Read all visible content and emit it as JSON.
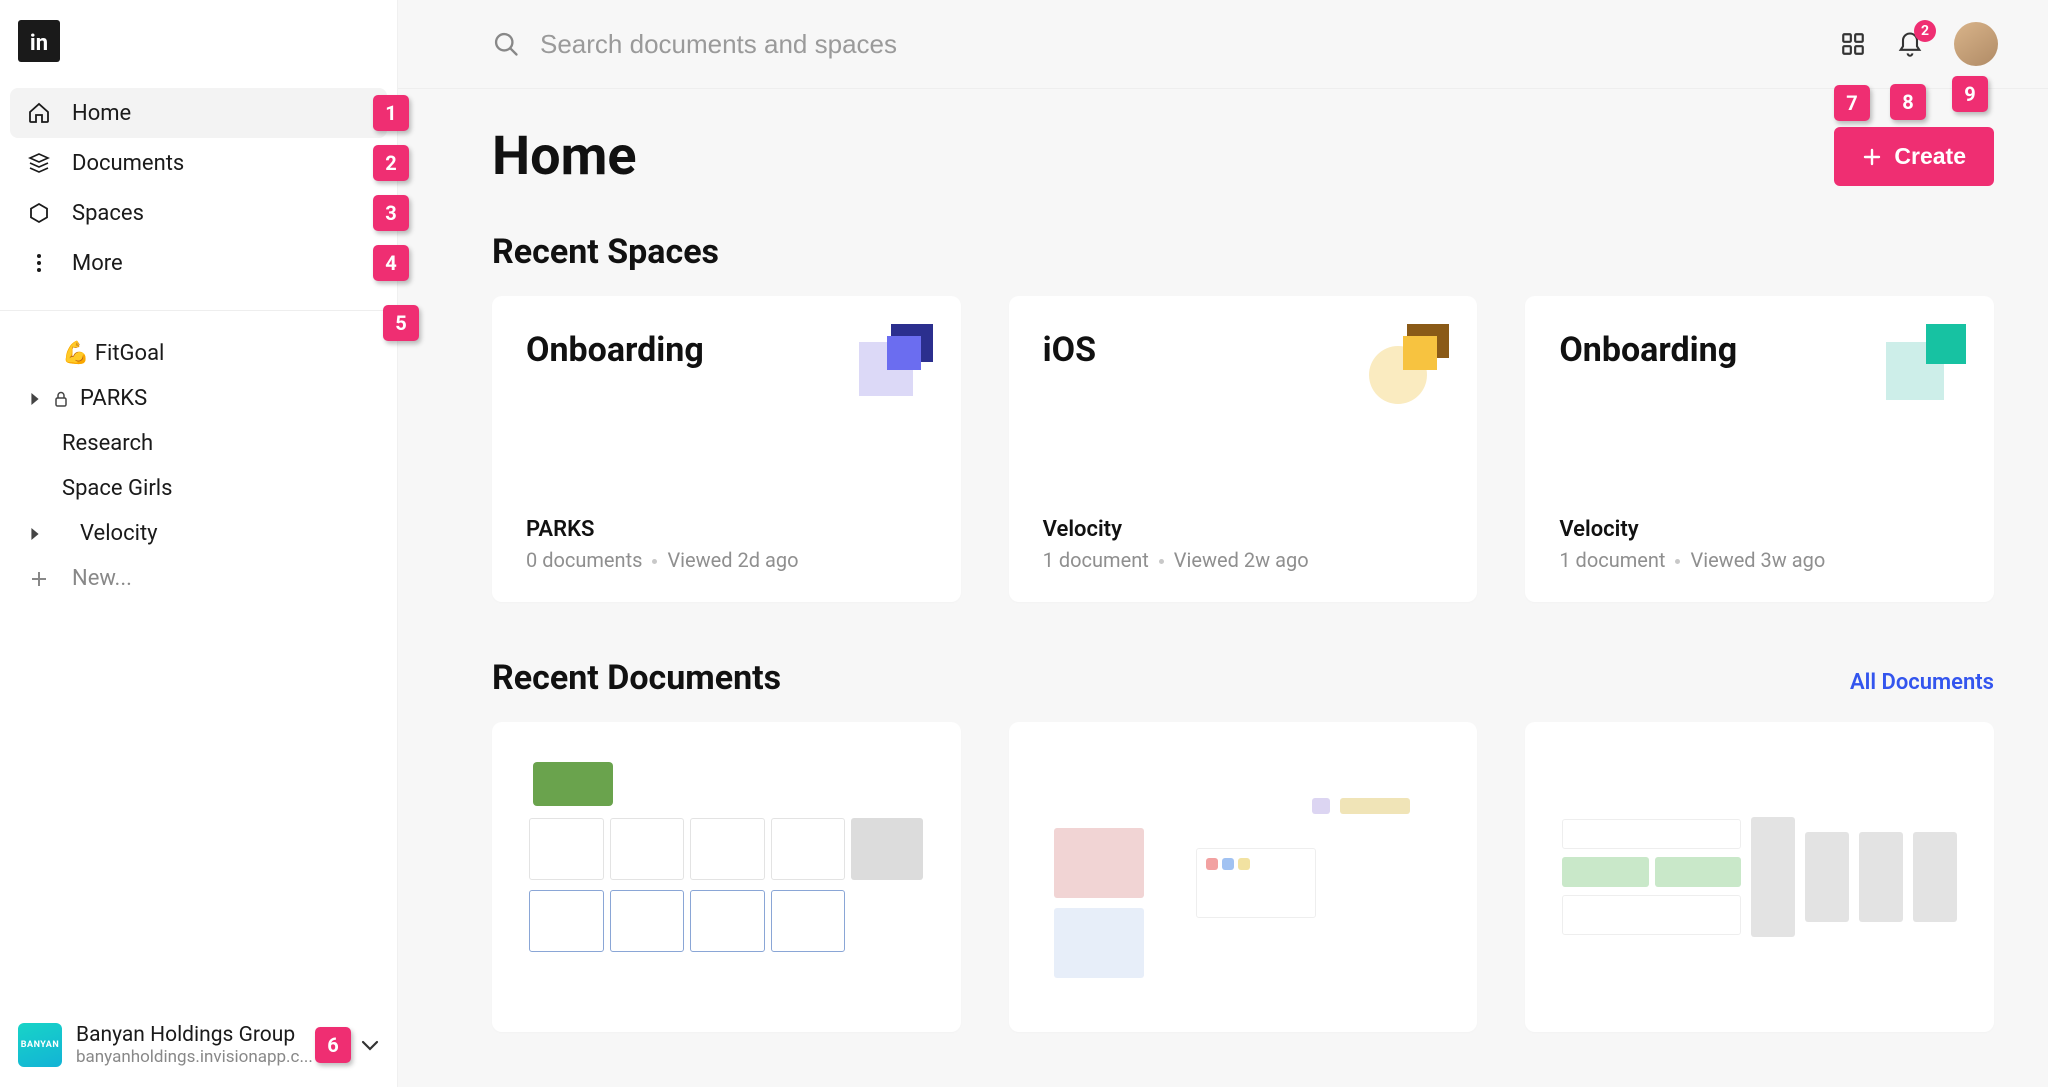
{
  "sidebar": {
    "nav": [
      {
        "label": "Home",
        "active": true
      },
      {
        "label": "Documents",
        "active": false
      },
      {
        "label": "Spaces",
        "active": false
      },
      {
        "label": "More",
        "active": false
      }
    ],
    "spaces": [
      {
        "label": "💪 FitGoal",
        "hasCaret": false,
        "locked": false
      },
      {
        "label": "PARKS",
        "hasCaret": true,
        "locked": true
      },
      {
        "label": "Research",
        "hasCaret": false,
        "locked": false
      },
      {
        "label": "Space Girls",
        "hasCaret": false,
        "locked": false
      },
      {
        "label": "Velocity",
        "hasCaret": true,
        "locked": false
      }
    ],
    "newLabel": "New...",
    "org": {
      "name": "Banyan Holdings Group",
      "url": "banyanholdings.invisionapp.c...",
      "avatarText": "BANYAN"
    }
  },
  "topbar": {
    "searchPlaceholder": "Search documents and spaces",
    "notificationCount": "2"
  },
  "page": {
    "title": "Home",
    "createLabel": "Create",
    "recentSpacesTitle": "Recent Spaces",
    "recentDocsTitle": "Recent Documents",
    "allDocsLabel": "All Documents",
    "spaces": [
      {
        "title": "Onboarding",
        "parent": "PARKS",
        "docs": "0 documents",
        "viewed": "Viewed 2d ago",
        "deco": "blue"
      },
      {
        "title": "iOS",
        "parent": "Velocity",
        "docs": "1 document",
        "viewed": "Viewed 2w ago",
        "deco": "yellow"
      },
      {
        "title": "Onboarding",
        "parent": "Velocity",
        "docs": "1 document",
        "viewed": "Viewed 3w ago",
        "deco": "teal"
      }
    ]
  },
  "markers": [
    "1",
    "2",
    "3",
    "4",
    "5",
    "6",
    "7",
    "8",
    "9"
  ]
}
